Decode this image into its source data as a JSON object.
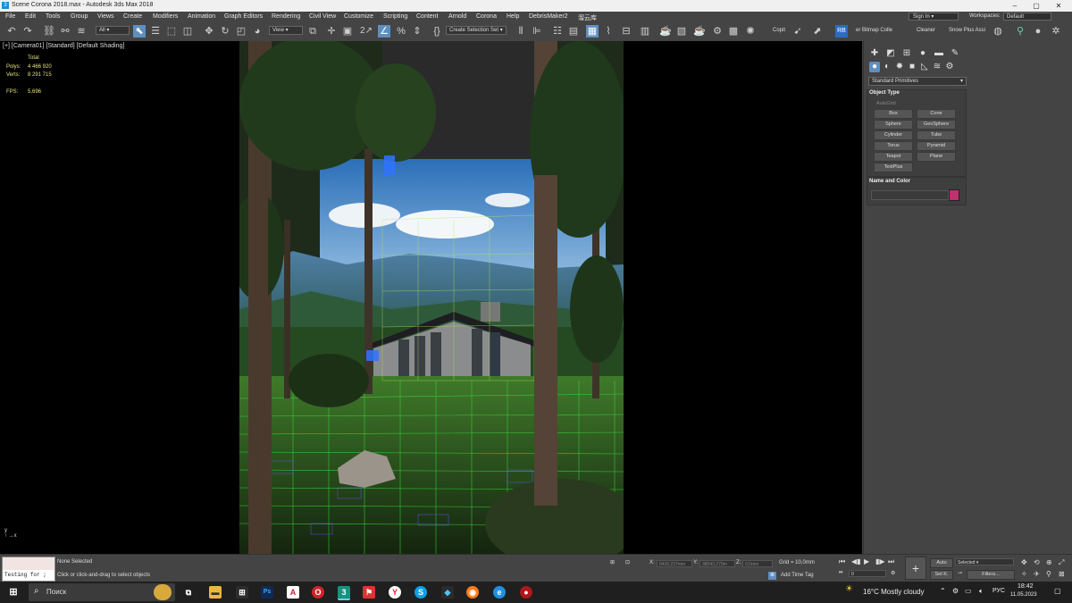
{
  "window": {
    "title": "Scene Corona 2018.max - Autodesk 3ds Max 2018",
    "app_icon": "3"
  },
  "menu": [
    "File",
    "Edit",
    "Tools",
    "Group",
    "Views",
    "Create",
    "Modifiers",
    "Animation",
    "Graph Editors",
    "Rendering",
    "Civil View",
    "Customize",
    "Scripting",
    "Content",
    "Arnold",
    "Corona",
    "Help",
    "DebrisMaker2",
    "溜云库"
  ],
  "signin": "Sign In",
  "workspaces": {
    "label": "Workspaces:",
    "value": "Default"
  },
  "toolbar": {
    "filter": "All",
    "refcoord": "View",
    "selection_set": "Create Selection Set",
    "copit": "Copit",
    "bitmap": "er Bitmap Colle",
    "cleaner": "Cleaner",
    "snow": "Snow Plus Assi",
    "rb": "RB",
    "snap_number": "2"
  },
  "viewport": {
    "label": "[+] [Camera01] [Standard] [Default Shading]",
    "stats": {
      "total_label": "Total",
      "polys_label": "Polys:",
      "polys": "4 466 920",
      "verts_label": "Verts:",
      "verts": "8 291 715",
      "fps_label": "FPS:",
      "fps": "5,696"
    },
    "axis_y": "y",
    "axis_x": "x"
  },
  "command_panel": {
    "category": "Standard Primitives",
    "object_type_title": "Object Type",
    "autogrid": "AutoGrid",
    "buttons": [
      "Box",
      "Cone",
      "Sphere",
      "GeoSphere",
      "Cylinder",
      "Tube",
      "Torus",
      "Pyramid",
      "Teapot",
      "Plane",
      "TextPlus"
    ],
    "name_color_title": "Name and Color",
    "swatch_color": "#c0306e"
  },
  "status": {
    "maxscript": "Testing for ;",
    "none_selected": "None Selected",
    "prompt": "Click or click-and-drag to select objects",
    "x_label": "X:",
    "y_label": "Y:",
    "z_label": "Z:",
    "x_value": "8426,237mm",
    "y_value": "38043,279m",
    "z_value": "0,0mm",
    "grid": "Grid = 10,0mm",
    "add_time_tag": "Add Time Tag",
    "frame": "0",
    "auto": "Auto",
    "selected": "Selected",
    "setk": "Set K.",
    "filters": "Filters..."
  },
  "taskbar": {
    "search": "Поиск",
    "weather": "16°C  Mostly cloudy",
    "lang": "РУС",
    "time": "18:42",
    "date": "11.05.2023"
  }
}
